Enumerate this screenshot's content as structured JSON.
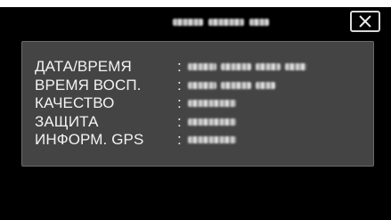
{
  "top_fragment": "",
  "close_icon": "close-x-icon",
  "header": {
    "title_obscured": true
  },
  "rows": [
    {
      "label": "ДАТА/ВРЕМЯ",
      "separator": ":",
      "value_obscured": true
    },
    {
      "label": "ВРЕМЯ ВОСП.",
      "separator": ":",
      "value_obscured": true
    },
    {
      "label": "КАЧЕСТВО",
      "separator": ":",
      "value_obscured": true
    },
    {
      "label": "ЗАЩИТА",
      "separator": ":",
      "value_obscured": true
    },
    {
      "label": "ИНФОРМ. GPS",
      "separator": ":",
      "value_obscured": true
    }
  ],
  "colors": {
    "screen_bg": "#000000",
    "panel_bg": "#444444",
    "text": "#f3f3f3",
    "button_border": "#d9d9d9"
  }
}
